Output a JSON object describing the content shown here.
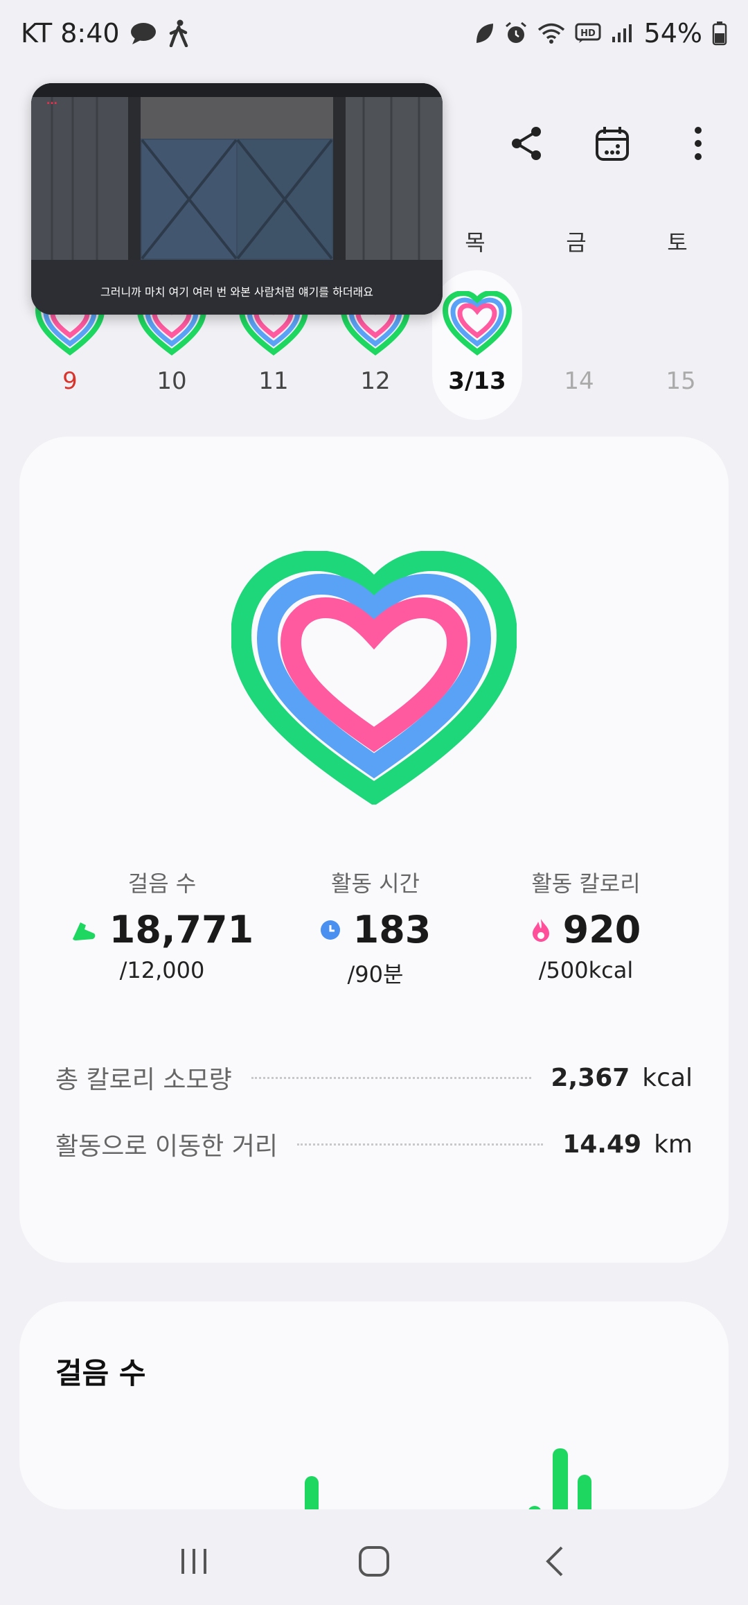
{
  "status_bar": {
    "carrier_time": "KT 8:40",
    "battery": "54%"
  },
  "pip_video": {
    "caption": "그러니까 마치 여기 여러 번 와본 사람처럼 얘기를 하더래요",
    "logo_text": "..."
  },
  "week": {
    "visible_days": [
      "목",
      "금",
      "토"
    ],
    "dates": [
      "9",
      "10",
      "11",
      "12",
      "3/13",
      "14",
      "15"
    ]
  },
  "summary": {
    "steps": {
      "label": "걸음 수",
      "value": "18,771",
      "goal": "/12,000",
      "icon": "shoe-icon",
      "color": "#1ed760"
    },
    "active_time": {
      "label": "활동 시간",
      "value": "183",
      "goal": "/90분",
      "icon": "clock-icon",
      "color": "#4a90f0"
    },
    "active_calories": {
      "label": "활동 칼로리",
      "value": "920",
      "goal": "/500kcal",
      "icon": "flame-icon",
      "color": "#ff4f9a"
    }
  },
  "details": {
    "total_calories": {
      "label": "총 칼로리 소모량",
      "value": "2,367",
      "unit": "kcal"
    },
    "distance": {
      "label": "활동으로 이동한 거리",
      "value": "14.49",
      "unit": "km"
    }
  },
  "steps_card": {
    "title": "걸음 수"
  },
  "colors": {
    "steps_ring": "#1ed760",
    "time_ring": "#4a90f0",
    "calorie_ring": "#ff4f9a",
    "sunday": "#d9342b"
  }
}
